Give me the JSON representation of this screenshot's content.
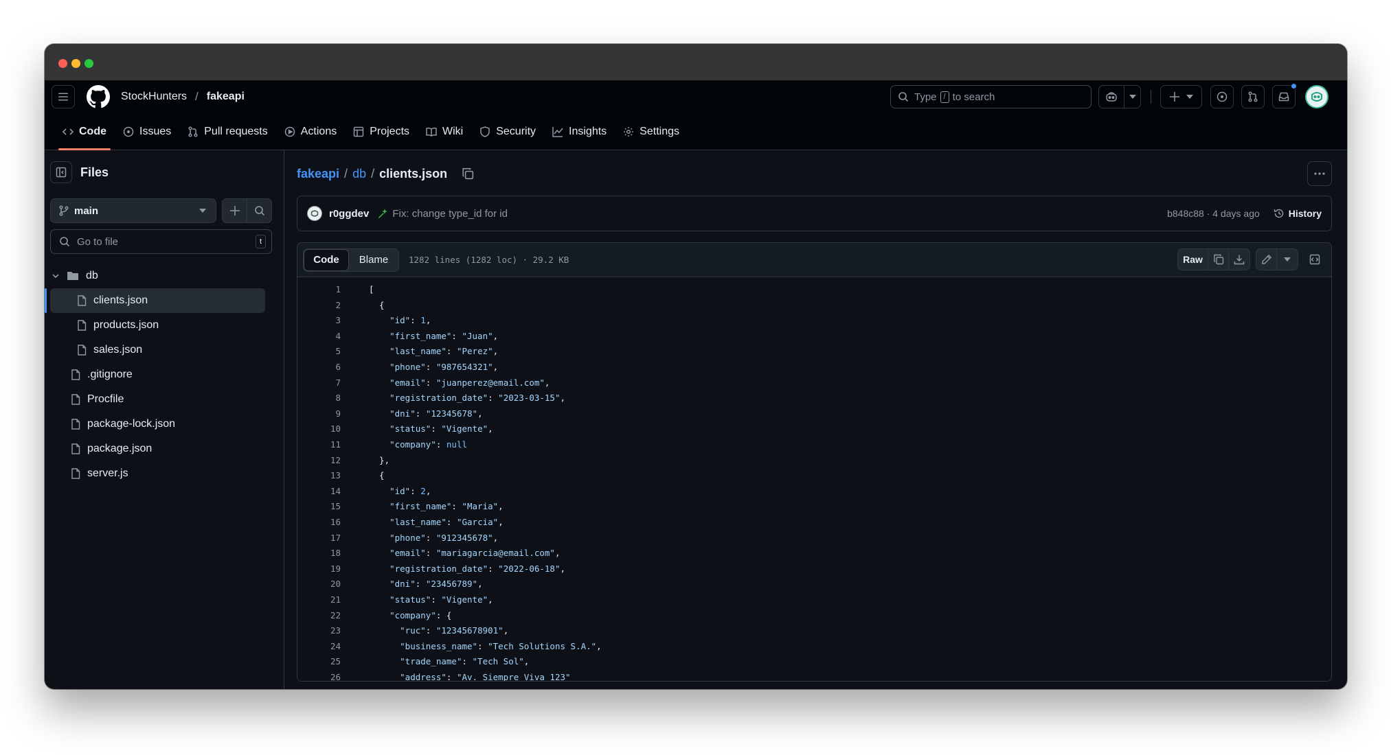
{
  "header": {
    "owner": "StockHunters",
    "separator": "/",
    "repo": "fakeapi",
    "search_prefix": "Type",
    "search_key": "/",
    "search_suffix": "to search"
  },
  "nav": {
    "tabs": [
      {
        "label": "Code"
      },
      {
        "label": "Issues"
      },
      {
        "label": "Pull requests"
      },
      {
        "label": "Actions"
      },
      {
        "label": "Projects"
      },
      {
        "label": "Wiki"
      },
      {
        "label": "Security"
      },
      {
        "label": "Insights"
      },
      {
        "label": "Settings"
      }
    ]
  },
  "sidebar": {
    "title": "Files",
    "branch": "main",
    "goto_placeholder": "Go to file",
    "goto_shortcut": "t",
    "folder": "db",
    "files": [
      "clients.json",
      "products.json",
      "sales.json",
      ".gitignore",
      "Procfile",
      "package-lock.json",
      "package.json",
      "server.js"
    ]
  },
  "breadcrumb": {
    "repo": "fakeapi",
    "dir": "db",
    "sep": "/",
    "file": "clients.json"
  },
  "commit": {
    "author": "r0ggdev",
    "message": "Fix: change type_id for id",
    "sha_time": "b848c88 · 4 days ago",
    "history": "History"
  },
  "file": {
    "tab_code": "Code",
    "tab_blame": "Blame",
    "meta": "1282 lines (1282 loc) · 29.2 KB",
    "raw": "Raw"
  },
  "code_lines": [
    "[",
    "  {",
    "    \"id\": 1,",
    "    \"first_name\": \"Juan\",",
    "    \"last_name\": \"Perez\",",
    "    \"phone\": \"987654321\",",
    "    \"email\": \"juanperez@email.com\",",
    "    \"registration_date\": \"2023-03-15\",",
    "    \"dni\": \"12345678\",",
    "    \"status\": \"Vigente\",",
    "    \"company\": null",
    "  },",
    "  {",
    "    \"id\": 2,",
    "    \"first_name\": \"Maria\",",
    "    \"last_name\": \"Garcia\",",
    "    \"phone\": \"912345678\",",
    "    \"email\": \"mariagarcia@email.com\",",
    "    \"registration_date\": \"2022-06-18\",",
    "    \"dni\": \"23456789\",",
    "    \"status\": \"Vigente\",",
    "    \"company\": {",
    "      \"ruc\": \"12345678901\",",
    "      \"business_name\": \"Tech Solutions S.A.\",",
    "      \"trade_name\": \"Tech Sol\",",
    "      \"address\": \"Av. Siempre Viva 123\""
  ],
  "colors": {
    "accent_blue": "#4493f8",
    "tab_underline": "#f78166",
    "traffic_red": "#ff5f57",
    "traffic_yellow": "#febc2e",
    "traffic_green": "#28c840"
  }
}
